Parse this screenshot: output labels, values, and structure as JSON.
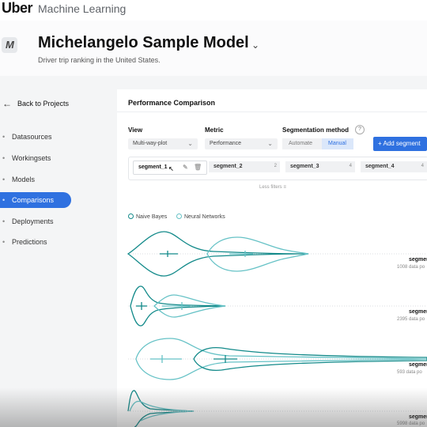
{
  "app": {
    "brand": "Uber",
    "product": "Machine Learning"
  },
  "model": {
    "logo_letter": "M",
    "title": "Michelangelo Sample  Model",
    "subtitle": "Driver trip ranking in the United States."
  },
  "sidebar": {
    "back_label": "Back to Projects",
    "items": [
      {
        "label": "Datasources",
        "active": false
      },
      {
        "label": "Workingsets",
        "active": false
      },
      {
        "label": "Models",
        "active": false
      },
      {
        "label": "Comparisons",
        "active": true
      },
      {
        "label": "Deployments",
        "active": false
      },
      {
        "label": "Predictions",
        "active": false
      }
    ]
  },
  "panel": {
    "title": "Performance Comparison",
    "view": {
      "label": "View",
      "value": "Multi-way-plot"
    },
    "metric": {
      "label": "Metric",
      "value": "Performance"
    },
    "segmentation": {
      "label": "Segmentation method",
      "options": [
        "Automate",
        "Manual"
      ],
      "selected": "Manual"
    },
    "add_segment": "+ Add segment",
    "segments": [
      {
        "name": "segment_1",
        "count": ""
      },
      {
        "name": "segment_2",
        "count": "2"
      },
      {
        "name": "segment_3",
        "count": "4"
      },
      {
        "name": "segment_4",
        "count": "4"
      }
    ],
    "less_filters": "Less filters  ≡",
    "legend": [
      {
        "name": "Naive Bayes",
        "color": "#138a8a"
      },
      {
        "name": "Neural Networks",
        "color": "#66c2c6"
      }
    ],
    "rows": [
      {
        "name": "segmen",
        "count": "1008 data po"
      },
      {
        "name": "segmen",
        "count": "2395 data po"
      },
      {
        "name": "segmen",
        "count": "593 data po"
      },
      {
        "name": "segmen",
        "count": "5998 data po"
      }
    ]
  },
  "colors": {
    "accent": "#2f71e0",
    "naive_bayes": "#138a8a",
    "neural_networks": "#66c2c6"
  },
  "icons": [
    "back-arrow-icon",
    "chevron-down-icon",
    "help-icon",
    "edit-icon",
    "trash-icon",
    "pointer-cursor-icon"
  ]
}
